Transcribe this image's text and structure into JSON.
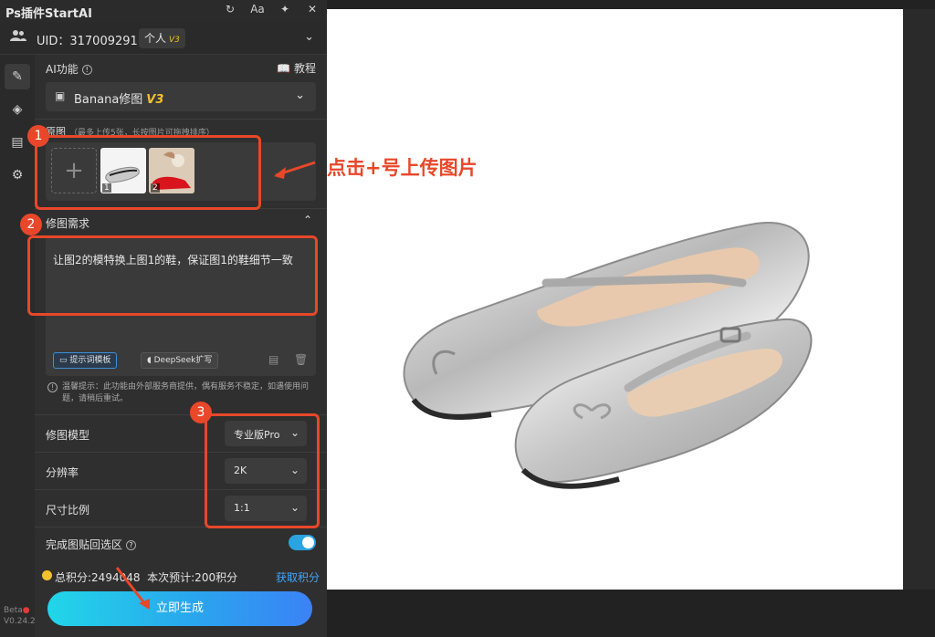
{
  "window": {
    "title": "Ps插件StartAI"
  },
  "titlebar_icons": [
    "refresh-icon",
    "font-size-icon",
    "pin-icon",
    "close-icon"
  ],
  "titlebar_font_glyph": "Aa",
  "user": {
    "uid_text": "UID：317009291",
    "plan_label": "个人",
    "plan_version": "V3"
  },
  "section_ai": {
    "label": "AI功能",
    "tutorial_label": "教程"
  },
  "feature_select": {
    "value": "Banana修图",
    "version": "V3"
  },
  "upload": {
    "label": "原图",
    "hint": "（最多上传5张，长按图片可拖拽排序）",
    "add_symbol": "+",
    "thumbnails": [
      {
        "index": "1"
      },
      {
        "index": "2"
      }
    ]
  },
  "requirement": {
    "label": "修图需求",
    "text": "让图2的模特换上图1的鞋，保证图1的鞋细节一致",
    "template_button": "提示词模板",
    "deepseek_button": "DeepSeek扩写"
  },
  "notice": "温馨提示：此功能由外部服务商提供，偶有服务不稳定，如遇使用问题，请稍后重试。",
  "options": [
    {
      "label": "修图模型",
      "value": "专业版Pro"
    },
    {
      "label": "分辨率",
      "value": "2K"
    },
    {
      "label": "尺寸比例",
      "value": "1:1"
    }
  ],
  "paste_back": {
    "label": "完成图贴回选区",
    "enabled": true
  },
  "points": {
    "total_text": "总积分:2494048",
    "estimate_text": "本次预计:200积分",
    "get_label": "获取积分"
  },
  "generate_button": "立即生成",
  "version": {
    "beta": "Beta",
    "number": "V0.24.2"
  },
  "annotations": {
    "numbers": [
      "1",
      "2",
      "3"
    ],
    "upload_tip": "点击+号上传图片",
    "color": "#e8472a"
  },
  "colors": {
    "accent": "#2aa3e0",
    "gold": "#f2c12e",
    "link": "#3ea6ff",
    "panel_bg": "#2f2f2f",
    "annotation": "#e8472a"
  }
}
